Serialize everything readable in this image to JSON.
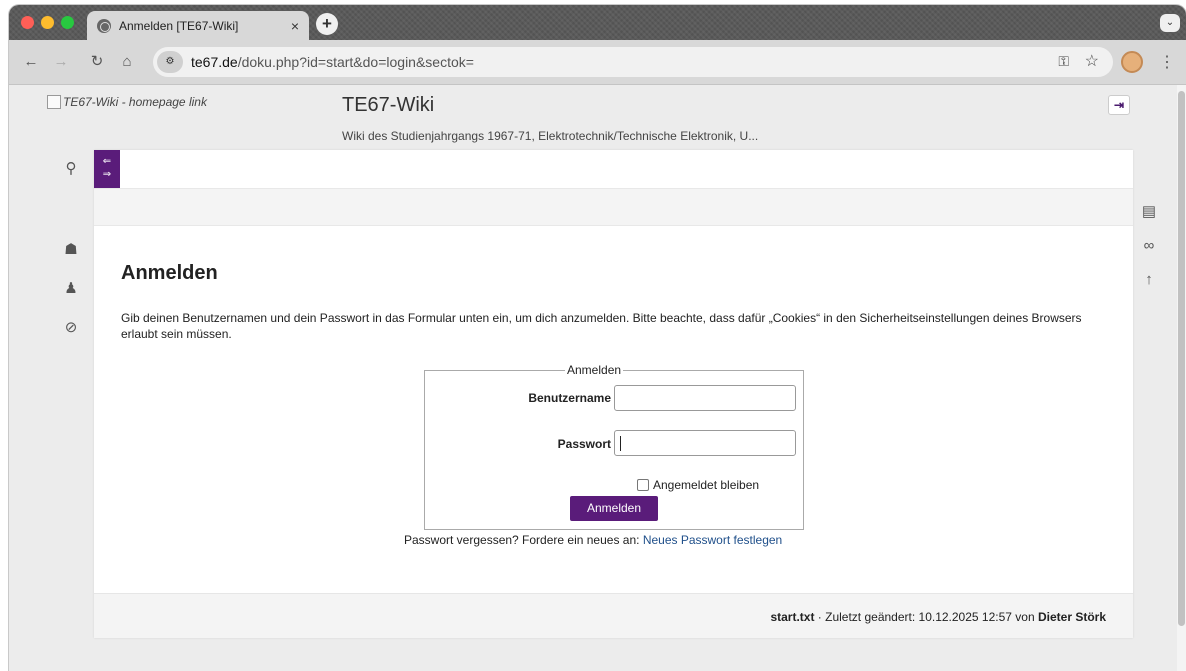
{
  "browser": {
    "tab_title": "Anmelden [TE67-Wiki]",
    "tab_close": "×",
    "new_tab": "+",
    "tab_menu": "⌄",
    "url_host": "te67.de",
    "url_path": "/doku.php?id=start&do=login&sectok="
  },
  "site": {
    "logo_alt": "TE67-Wiki - homepage link",
    "title": "TE67-Wiki",
    "tagline": "Wiki des Studienjahrgangs 1967-71, Elektrotechnik/Technische Elektronik, U..."
  },
  "page": {
    "heading": "Anmelden",
    "intro": "Gib deinen Benutzernamen und dein Passwort in das Formular unten ein, um dich anzumelden. Bitte beachte, dass dafür „Cookies“ in den Sicherheitseinstellungen deines Browsers erlaubt sein müssen."
  },
  "form": {
    "legend": "Anmelden",
    "username_label": "Benutzername",
    "username_value": "",
    "password_label": "Passwort",
    "password_value": "",
    "remember_label": "Angemeldet bleiben",
    "remember_checked": false,
    "submit_label": "Anmelden"
  },
  "forgot": {
    "text": "Passwort vergessen? Fordere ein neues an:",
    "link": "Neues Passwort festlegen"
  },
  "footer": {
    "page_name": "start.txt",
    "changed_text": "· Zuletzt geändert: 10.12.2025 12:57 von",
    "author": "Dieter Störk"
  },
  "colors": {
    "accent": "#5a1c7a",
    "link": "#1f4f8a"
  }
}
